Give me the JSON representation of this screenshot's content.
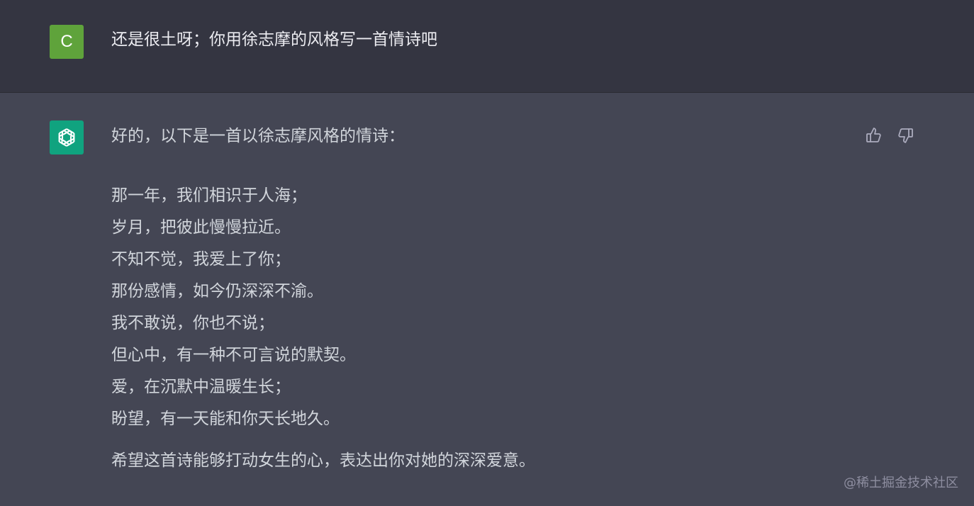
{
  "user_message": {
    "avatar_letter": "C",
    "avatar_color": "#5fa33b",
    "text": "还是很土呀；你用徐志摩的风格写一首情诗吧"
  },
  "assistant_message": {
    "avatar_icon": "openai-logo-icon",
    "avatar_color": "#10a37f",
    "intro": "好的，以下是一首以徐志摩风格的情诗：",
    "poem_lines": [
      "那一年，我们相识于人海；",
      "岁月，把彼此慢慢拉近。",
      "不知不觉，我爱上了你；",
      "那份感情，如今仍深深不渝。",
      "我不敢说，你也不说；",
      "但心中，有一种不可言说的默契。",
      "爱，在沉默中温暖生长；",
      "盼望，有一天能和你天长地久。"
    ],
    "outro": "希望这首诗能够打动女生的心，表达出你对她的深深爱意。"
  },
  "feedback": {
    "thumbs_up_icon": "thumbs-up-icon",
    "thumbs_down_icon": "thumbs-down-icon"
  },
  "watermark": "@稀土掘金技术社区"
}
